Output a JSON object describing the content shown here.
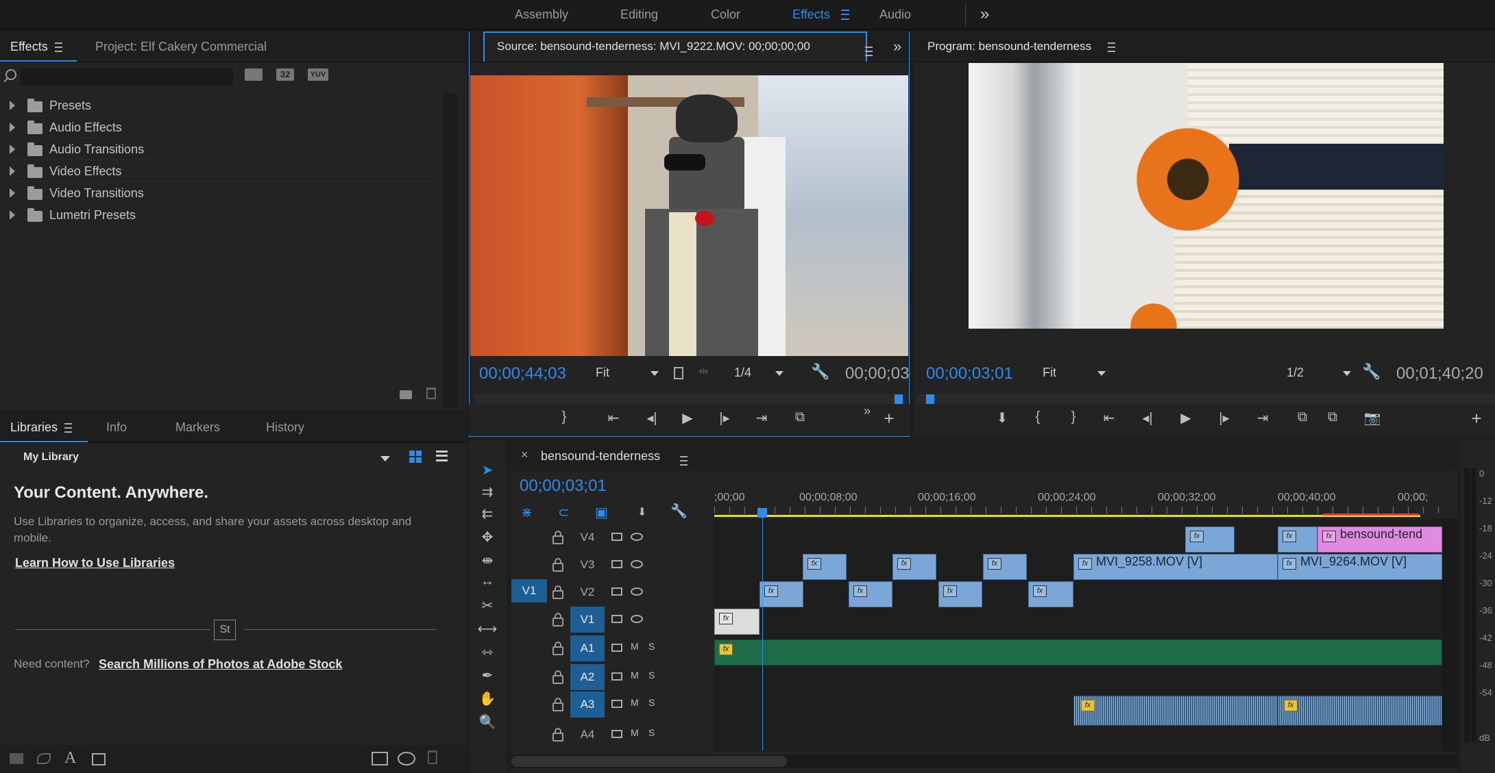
{
  "workspace": {
    "tabs": [
      "Assembly",
      "Editing",
      "Color",
      "Effects",
      "Audio"
    ],
    "active": "Effects",
    "overflow": "»"
  },
  "effects_panel": {
    "tab_effects": "Effects",
    "tab_project": "Project: Elf Cakery Commercial",
    "search_placeholder": "",
    "filter_btns": [
      "32",
      "YUV"
    ],
    "items": [
      {
        "label": "Presets",
        "icon": "preset-folder-icon"
      },
      {
        "label": "Audio Effects",
        "icon": "folder-icon"
      },
      {
        "label": "Audio Transitions",
        "icon": "folder-icon"
      },
      {
        "label": "Video Effects",
        "icon": "folder-icon"
      },
      {
        "label": "Video Transitions",
        "icon": "folder-icon"
      },
      {
        "label": "Lumetri Presets",
        "icon": "preset-folder-icon"
      }
    ]
  },
  "libraries_panel": {
    "tabs": [
      "Libraries",
      "Info",
      "Markers",
      "History"
    ],
    "library_name": "My Library",
    "heading": "Your Content. Anywhere.",
    "body": "Use Libraries to organize, access, and share your assets across desktop and mobile.",
    "link": "Learn How to Use Libraries",
    "st_badge": "St",
    "need_content": "Need content?",
    "stock_link": "Search Millions of Photos at Adobe Stock"
  },
  "source_monitor": {
    "title": "Source: bensound-tenderness: MVI_9222.MOV: 00;00;00;00",
    "timecode": "00;00;44;03",
    "fit": "Fit",
    "resolution": "1/4",
    "duration": "00;00;03",
    "overflow": "»"
  },
  "program_monitor": {
    "title": "Program: bensound-tenderness",
    "timecode": "00;00;03;01",
    "fit": "Fit",
    "resolution": "1/2",
    "duration": "00;01;40;20"
  },
  "timeline": {
    "sequence": "bensound-tenderness",
    "close": "×",
    "timecode": "00;00;03;01",
    "ruler": [
      ";00;00",
      "00;00;08;00",
      "00;00;16;00",
      "00;00;24;00",
      "00;00;32;00",
      "00;00;40;00",
      "00;00;"
    ],
    "tracks": [
      {
        "name": "V4",
        "src": "",
        "kind": "video"
      },
      {
        "name": "V3",
        "src": "",
        "kind": "video"
      },
      {
        "name": "V2",
        "src": "V1",
        "kind": "video"
      },
      {
        "name": "V1",
        "src": "",
        "kind": "video",
        "target": true
      },
      {
        "name": "A1",
        "kind": "audio",
        "target": true
      },
      {
        "name": "A2",
        "kind": "audio",
        "target": true
      },
      {
        "name": "A3",
        "kind": "audio",
        "target": true
      },
      {
        "name": "A4",
        "kind": "audio"
      }
    ],
    "clip_labels": {
      "mvi9258": "MVI_9258.MOV [V]",
      "mvi9264": "MVI_9264.MOV [V]",
      "bensound": "bensound-tend"
    },
    "fx": "fx",
    "m": "M",
    "s": "S"
  },
  "meter": {
    "labels": [
      "0",
      "-12",
      "-18",
      "-24",
      "-30",
      "-36",
      "-42",
      "-48",
      "-54",
      "dB"
    ]
  },
  "colors": {
    "accent": "#2d8ceb",
    "video_clip": "#7aa7d8",
    "audio_clip": "#1e6b4a",
    "pink_clip": "#e08be0",
    "work_area": "#e7e31a"
  }
}
